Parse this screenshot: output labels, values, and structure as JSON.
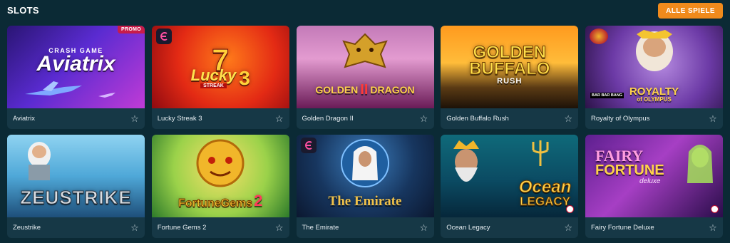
{
  "header": {
    "title": "SLOTS",
    "all_games_label": "ALLE SPIELE"
  },
  "colors": {
    "page_bg": "#0b2a35",
    "card_bg": "#163846",
    "accent": "#f08a1c",
    "promo_badge": "#c81c4a"
  },
  "games": [
    {
      "name": "Aviatrix",
      "art_lines": [
        "CRASH GAME",
        "Aviatrix"
      ],
      "badge": "PROMO",
      "icon": "star-outline-icon"
    },
    {
      "name": "Lucky Streak 3",
      "art_lines": [
        "7",
        "Lucky",
        "STREAK",
        "3"
      ],
      "icon": "star-outline-icon"
    },
    {
      "name": "Golden Dragon II",
      "art_lines": [
        "GOLDEN",
        "II",
        "DRAGON"
      ],
      "icon": "star-outline-icon"
    },
    {
      "name": "Golden Buffalo Rush",
      "art_lines": [
        "GOLDEN",
        "BUFFALO",
        "RUSH"
      ],
      "icon": "star-outline-icon"
    },
    {
      "name": "Royalty of Olympus",
      "art_lines": [
        "ROYALTY",
        "of OLYMPUS"
      ],
      "provider_tag": "BAR BAR BANG",
      "icon": "star-outline-icon"
    },
    {
      "name": "Zeustrike",
      "art_lines": [
        "ZEUSTRIKE"
      ],
      "icon": "star-outline-icon"
    },
    {
      "name": "Fortune Gems 2",
      "art_lines": [
        "FortuneGems",
        "2"
      ],
      "icon": "star-outline-icon"
    },
    {
      "name": "The Emirate",
      "art_lines": [
        "The Emirate"
      ],
      "icon": "star-outline-icon"
    },
    {
      "name": "Ocean Legacy",
      "art_lines": [
        "Ocean",
        "LEGACY"
      ],
      "icon": "star-outline-icon"
    },
    {
      "name": "Fairy Fortune Deluxe",
      "art_lines": [
        "FAIRY",
        "FORTUNE",
        "deluxe"
      ],
      "icon": "star-outline-icon"
    }
  ]
}
